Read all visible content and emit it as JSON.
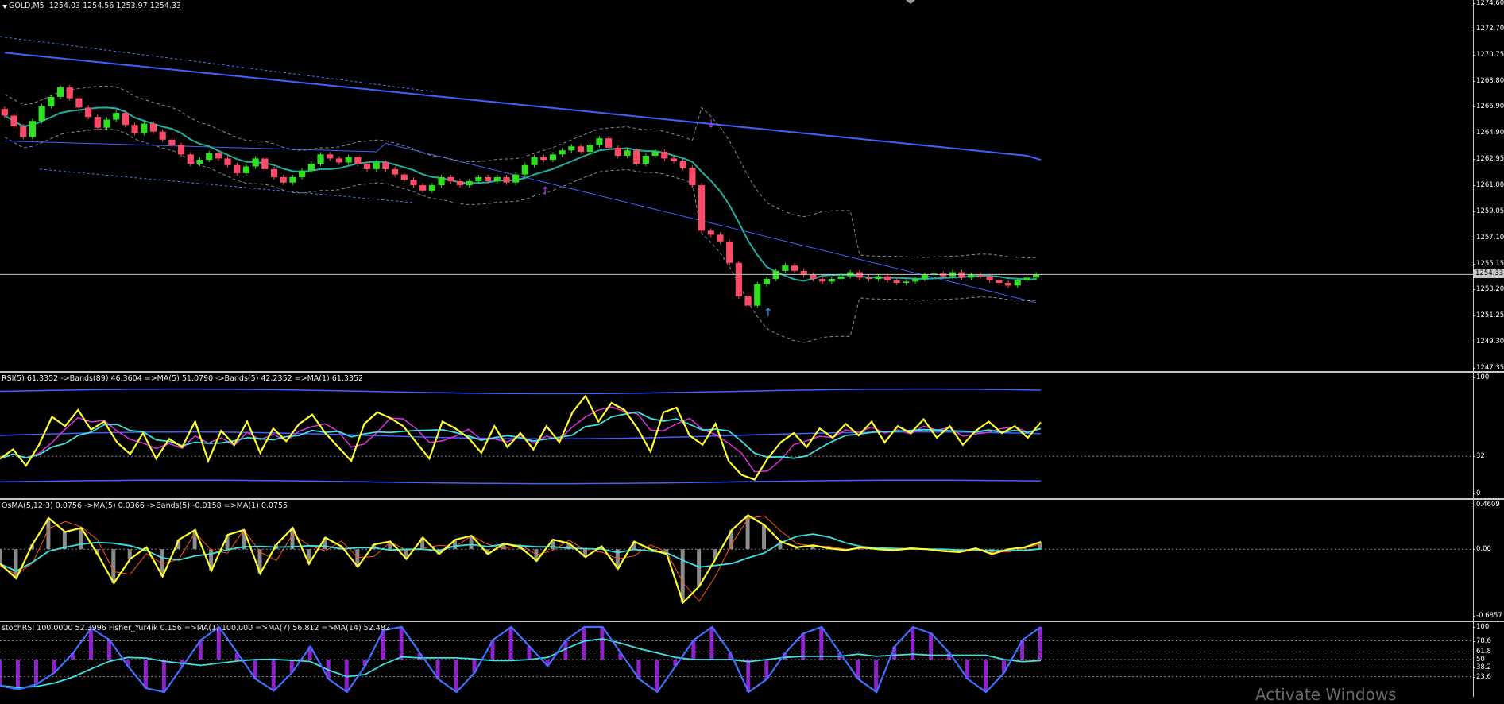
{
  "chart_data": [
    {
      "type": "line",
      "panel": "price",
      "title": "GOLD,M5",
      "ohlc_header": "1254.03 1254.56 1253.97 1254.33",
      "ylim": [
        1247.35,
        1274.6
      ],
      "y_ticks": [
        "1274.60",
        "1272.70",
        "1270.75",
        "1268.80",
        "1266.90",
        "1264.90",
        "1262.95",
        "1261.00",
        "1259.05",
        "1257.10",
        "1255.15",
        "1254.33",
        "1253.20",
        "1251.25",
        "1249.30",
        "1247.35"
      ],
      "current_price": "1254.33",
      "candles_close": [
        1266.2,
        1265.4,
        1264.6,
        1265.8,
        1266.9,
        1267.6,
        1268.3,
        1267.5,
        1266.8,
        1266.1,
        1265.3,
        1265.9,
        1266.4,
        1265.5,
        1264.9,
        1265.6,
        1265.0,
        1264.4,
        1264.0,
        1263.3,
        1262.6,
        1262.9,
        1263.4,
        1263.0,
        1262.5,
        1261.9,
        1262.4,
        1263.0,
        1262.2,
        1261.6,
        1261.2,
        1261.6,
        1262.1,
        1262.6,
        1263.3,
        1263.0,
        1262.7,
        1263.1,
        1262.6,
        1262.2,
        1262.7,
        1262.2,
        1261.8,
        1261.4,
        1261.0,
        1260.6,
        1261.0,
        1261.6,
        1261.3,
        1261.0,
        1261.3,
        1261.6,
        1261.3,
        1261.6,
        1261.2,
        1261.8,
        1262.5,
        1263.1,
        1262.9,
        1263.3,
        1263.6,
        1263.9,
        1263.5,
        1264.0,
        1264.5,
        1263.8,
        1263.2,
        1263.6,
        1262.6,
        1263.2,
        1263.5,
        1263.0,
        1262.8,
        1262.3,
        1261.0,
        1257.6,
        1257.3,
        1256.8,
        1255.2,
        1252.7,
        1252.0,
        1253.6,
        1254.0,
        1254.6,
        1255.0,
        1254.6,
        1254.3,
        1254.0,
        1253.8,
        1254.0,
        1254.2,
        1254.5,
        1254.1,
        1254.0,
        1254.2,
        1253.9,
        1253.7,
        1253.8,
        1254.0,
        1254.3,
        1254.4,
        1254.2,
        1254.5,
        1254.1,
        1254.3,
        1254.2,
        1253.9,
        1253.7,
        1253.5,
        1253.9,
        1254.1,
        1254.33
      ]
    },
    {
      "type": "line",
      "panel": "rsi",
      "title": "RSI(5) 61.3352 ->Bands(89) 46.3604 =>MA(5) 51.0790 ->Bands(5) 42.2352 =>MA(1) 61.3352",
      "ylim": [
        0,
        100
      ],
      "y_ticks": [
        "100",
        "32",
        "0"
      ],
      "series": [
        {
          "values": [
            30,
            38,
            24,
            42,
            66,
            58,
            72,
            55,
            62,
            44,
            34,
            52,
            30,
            47,
            40,
            62,
            28,
            54,
            42,
            62,
            35,
            56,
            45,
            60,
            68,
            52,
            40,
            28,
            60,
            70,
            65,
            58,
            44,
            30,
            62,
            56,
            48,
            35,
            58,
            40,
            52,
            38,
            58,
            44,
            70,
            84,
            62,
            78,
            72,
            56,
            36,
            70,
            74,
            50,
            42,
            60,
            28,
            16,
            12,
            30,
            44,
            52,
            40,
            56,
            48,
            60,
            50,
            62,
            44,
            58,
            52,
            64,
            48,
            58,
            42,
            54,
            62,
            52,
            58,
            48,
            61.3
          ]
        }
      ]
    },
    {
      "type": "line",
      "panel": "osma",
      "title": "OsMA(5,12,3) 0.0756 ->MA(5) 0.0366 ->Bands(5) -0.0158 =>MA(1) 0.0755",
      "ylim": [
        -0.6857,
        0.4609
      ],
      "y_ticks": [
        "0.4609",
        "0.00",
        "-0.6857"
      ],
      "series": [
        {
          "values": [
            -0.15,
            -0.3,
            0.05,
            0.32,
            0.18,
            0.22,
            -0.05,
            -0.35,
            -0.1,
            0.02,
            -0.28,
            0.1,
            0.2,
            -0.22,
            0.15,
            0.2,
            -0.25,
            0.05,
            0.22,
            -0.15,
            0.12,
            0.03,
            -0.18,
            0.05,
            0.08,
            -0.1,
            0.12,
            -0.05,
            0.1,
            0.14,
            -0.05,
            0.06,
            0.02,
            -0.12,
            0.1,
            0.06,
            -0.08,
            0.03,
            -0.2,
            0.08,
            0.0,
            -0.05,
            -0.55,
            -0.38,
            -0.1,
            0.2,
            0.35,
            0.25,
            0.08,
            0.02,
            0.04,
            0.01,
            -0.01,
            0.02,
            0.0,
            -0.01,
            0.01,
            0.0,
            -0.02,
            -0.03,
            0.01,
            -0.05,
            0.0,
            0.02,
            0.0755
          ]
        }
      ]
    },
    {
      "type": "line",
      "panel": "stochrsi",
      "title": "stochRSI 100.0000 52.3996 Fisher_Yur4ik 0.156 =>MA(1) 100.000 =>MA(7) 56.812 =>MA(14) 52.482",
      "ylim": [
        0,
        100
      ],
      "y_ticks": [
        "100",
        "78.6",
        "61.8",
        "50",
        "38.2",
        "23.6"
      ],
      "series": [
        {
          "values": [
            10,
            4,
            12,
            30,
            60,
            98,
            80,
            40,
            6,
            0,
            40,
            80,
            100,
            60,
            20,
            2,
            30,
            70,
            20,
            0,
            40,
            95,
            100,
            60,
            20,
            0,
            30,
            80,
            100,
            70,
            40,
            80,
            100,
            100,
            60,
            20,
            0,
            40,
            80,
            100,
            60,
            0,
            20,
            60,
            90,
            100,
            60,
            20,
            0,
            70,
            100,
            90,
            60,
            20,
            0,
            30,
            80,
            100
          ]
        }
      ]
    }
  ],
  "watermark": "Activate Windows",
  "colors": {
    "background": "#000000",
    "bull_candle": "#30e020",
    "bear_candle": "#ff4a68",
    "ma_slow": "#4060ff",
    "ma_mid": "#20b0a0",
    "rsi_line": "#ffff30",
    "cyan_line": "#40e0e0",
    "magenta_line": "#e030e0",
    "orange_line": "#ff5020"
  }
}
